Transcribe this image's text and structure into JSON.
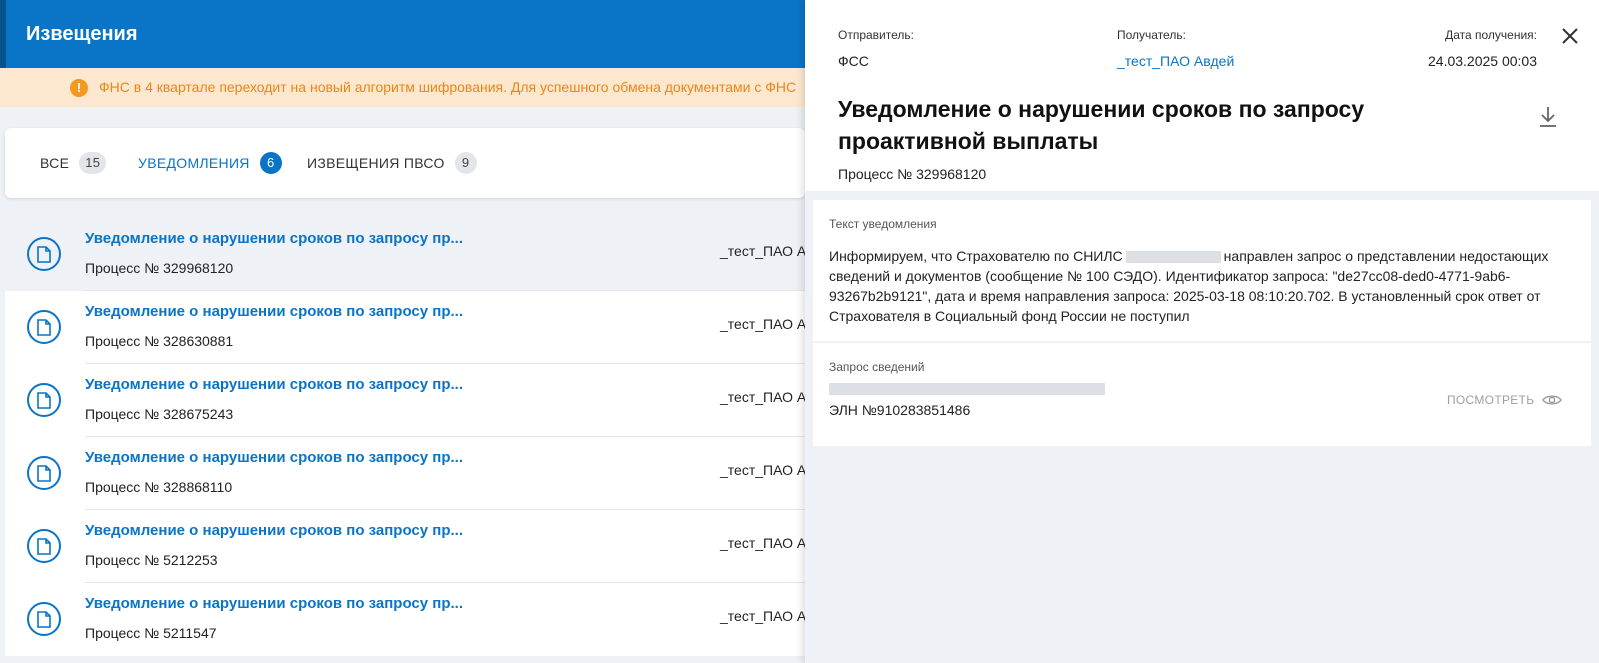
{
  "header": {
    "title": "Извещения"
  },
  "alert": {
    "icon": "warning-icon",
    "text": "ФНС в 4 квартале переходит на новый алгоритм шифрования. Для успешного обмена документами с ФНС"
  },
  "tabs": [
    {
      "label": "ВСЕ",
      "count": "15"
    },
    {
      "label": "УВЕДОМЛЕНИЯ",
      "count": "6"
    },
    {
      "label": "ИЗВЕЩЕНИЯ ПВСО",
      "count": "9"
    }
  ],
  "list": [
    {
      "title": "Уведомление о нарушении сроков по запросу пр...",
      "process": "Процесс № 329968120",
      "org": "_тест_ПАО Ав"
    },
    {
      "title": "Уведомление о нарушении сроков по запросу пр...",
      "process": "Процесс № 328630881",
      "org": "_тест_ПАО Ав"
    },
    {
      "title": "Уведомление о нарушении сроков по запросу пр...",
      "process": "Процесс № 328675243",
      "org": "_тест_ПАО Ав"
    },
    {
      "title": "Уведомление о нарушении сроков по запросу пр...",
      "process": "Процесс № 328868110",
      "org": "_тест_ПАО Ав"
    },
    {
      "title": "Уведомление о нарушении сроков по запросу пр...",
      "process": "Процесс № 5212253",
      "org": "_тест_ПАО Ав"
    },
    {
      "title": "Уведомление о нарушении сроков по запросу пр...",
      "process": "Процесс № 5211547",
      "org": "_тест_ПАО Ав"
    }
  ],
  "panel": {
    "sender_label": "Отправитель:",
    "sender": "ФСС",
    "recipient_label": "Получатель:",
    "recipient": "_тест_ПАО Авдей",
    "date_label": "Дата получения:",
    "date": "24.03.2025 00:03",
    "title": "Уведомление о нарушении сроков по запросу проактивной выплаты",
    "process": "Процесс № 329968120",
    "notice_label": "Текст уведомления",
    "notice_text_1": "Информируем, что Страхователю по СНИЛС",
    "notice_text_2": "направлен запрос о представлении недостающих сведений и документов (сообщение № 100 СЭДО). Идентификатор запроса: \"de27cc08-ded0-4771-9ab6-93267b2b9121\", дата и время направления запроса: 2025-03-18 08:10:20.702. В установленный срок ответ от Страхователя в Социальный фонд России не поступил",
    "request_label": "Запрос сведений",
    "eln": "ЭЛН №910283851486",
    "view_label": "ПОСМОТРЕТЬ"
  },
  "colors": {
    "primary": "#0a74c6",
    "alert_bg": "#fde8cf",
    "alert_text": "#e8861a"
  }
}
